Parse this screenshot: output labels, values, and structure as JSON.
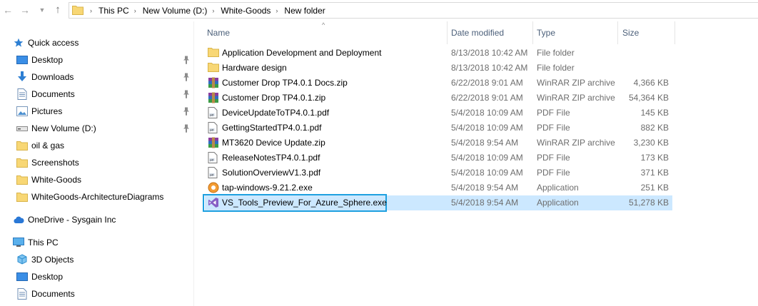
{
  "address": {
    "breadcrumbs": [
      "This PC",
      "New Volume (D:)",
      "White-Goods",
      "New folder"
    ]
  },
  "columns": {
    "name": "Name",
    "date": "Date modified",
    "type": "Type",
    "size": "Size"
  },
  "nav": {
    "quick_access": "Quick access",
    "quick_items": [
      {
        "label": "Desktop",
        "icon": "desktop-icon",
        "pinned": true
      },
      {
        "label": "Downloads",
        "icon": "downloads-icon",
        "pinned": true
      },
      {
        "label": "Documents",
        "icon": "documents-icon",
        "pinned": true
      },
      {
        "label": "Pictures",
        "icon": "pictures-icon",
        "pinned": true
      },
      {
        "label": "New Volume (D:)",
        "icon": "drive-icon",
        "pinned": true
      },
      {
        "label": "oil & gas",
        "icon": "folder-icon",
        "pinned": false
      },
      {
        "label": "Screenshots",
        "icon": "folder-icon",
        "pinned": false
      },
      {
        "label": "White-Goods",
        "icon": "folder-icon",
        "pinned": false
      },
      {
        "label": "WhiteGoods-ArchitectureDiagrams",
        "icon": "folder-icon",
        "pinned": false
      }
    ],
    "onedrive": "OneDrive - Sysgain Inc",
    "this_pc": "This PC",
    "pc_items": [
      {
        "label": "3D Objects",
        "icon": "3d-objects-icon"
      },
      {
        "label": "Desktop",
        "icon": "desktop-icon"
      },
      {
        "label": "Documents",
        "icon": "documents-icon"
      }
    ]
  },
  "files": [
    {
      "name": "Application Development and Deployment",
      "date": "8/13/2018 10:42 AM",
      "type": "File folder",
      "size": "",
      "icon": "folder-icon"
    },
    {
      "name": "Hardware design",
      "date": "8/13/2018 10:42 AM",
      "type": "File folder",
      "size": "",
      "icon": "folder-icon"
    },
    {
      "name": "Customer Drop TP4.0.1 Docs.zip",
      "date": "6/22/2018 9:01 AM",
      "type": "WinRAR ZIP archive",
      "size": "4,366 KB",
      "icon": "winrar-icon"
    },
    {
      "name": "Customer Drop TP4.0.1.zip",
      "date": "6/22/2018 9:01 AM",
      "type": "WinRAR ZIP archive",
      "size": "54,364 KB",
      "icon": "winrar-icon"
    },
    {
      "name": "DeviceUpdateToTP4.0.1.pdf",
      "date": "5/4/2018 10:09 AM",
      "type": "PDF File",
      "size": "145 KB",
      "icon": "pdf-icon"
    },
    {
      "name": "GettingStartedTP4.0.1.pdf",
      "date": "5/4/2018 10:09 AM",
      "type": "PDF File",
      "size": "882 KB",
      "icon": "pdf-icon"
    },
    {
      "name": "MT3620 Device Update.zip",
      "date": "5/4/2018 9:54 AM",
      "type": "WinRAR ZIP archive",
      "size": "3,230 KB",
      "icon": "winrar-icon"
    },
    {
      "name": "ReleaseNotesTP4.0.1.pdf",
      "date": "5/4/2018 10:09 AM",
      "type": "PDF File",
      "size": "173 KB",
      "icon": "pdf-icon"
    },
    {
      "name": "SolutionOverviewV1.3.pdf",
      "date": "5/4/2018 10:09 AM",
      "type": "PDF File",
      "size": "371 KB",
      "icon": "pdf-icon"
    },
    {
      "name": "tap-windows-9.21.2.exe",
      "date": "5/4/2018 9:54 AM",
      "type": "Application",
      "size": "251 KB",
      "icon": "installer-icon"
    },
    {
      "name": "VS_Tools_Preview_For_Azure_Sphere.exe",
      "date": "5/4/2018 9:54 AM",
      "type": "Application",
      "size": "51,278 KB",
      "icon": "visual-studio-icon",
      "selected": true
    }
  ],
  "colors": {
    "selection": "#cce8ff",
    "highlight_border": "#1ea0e0",
    "header_text": "#4c607a",
    "folder": "#f8d775"
  }
}
